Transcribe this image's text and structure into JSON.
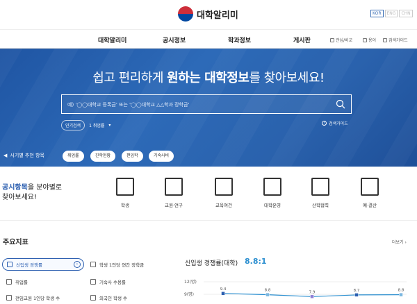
{
  "header": {
    "logo_text": "대학알리미",
    "langs": [
      "KOR",
      "ENG",
      "CHN"
    ],
    "active_lang": "KOR"
  },
  "nav": {
    "items": [
      "대학알리미",
      "공시정보",
      "학과정보",
      "게시판"
    ],
    "util": [
      "관심/비교",
      "용어",
      "검색가이드"
    ]
  },
  "hero": {
    "headline_pre": "쉽고 편리하게 ",
    "headline_bold1": "원하는 대학정보",
    "headline_post": "를 찾아보세요!",
    "search_placeholder": "예) '◯◯대학교 등록금' 또는 '◯◯대학교 △△학과 장학금'",
    "popular_label": "인기검색",
    "popular_value": "1 취업률",
    "guide_label": "검색가이드"
  },
  "recommend": {
    "label": "시기별 추천 항목",
    "chips": [
      "취업률",
      "진학현황",
      "편입학",
      "기숙사비"
    ]
  },
  "category": {
    "title_bold": "공시항목",
    "title_rest1": "을 분야별로",
    "title_rest2": "찾아보세요!",
    "items": [
      {
        "label": "학생",
        "icon": "student-card-icon"
      },
      {
        "label": "교원·연구",
        "icon": "lecture-board-icon"
      },
      {
        "label": "교육여건",
        "icon": "book-icon"
      },
      {
        "label": "대학운영",
        "icon": "building-icon"
      },
      {
        "label": "산학협력",
        "icon": "briefcase-icon"
      },
      {
        "label": "예·결산",
        "icon": "calculator-icon"
      }
    ]
  },
  "indicators": {
    "title": "주요지표",
    "more": "더보기",
    "items": [
      "신입생 경쟁률",
      "학생 1인당 연간 장학금",
      "취업률",
      "기숙사 수용률",
      "전임교원 1인당 학생 수",
      "외국인 학생 수"
    ],
    "active": "신입생 경쟁률"
  },
  "chart_data": {
    "type": "line",
    "title": "신입생 경쟁률(대학)",
    "summary": "8.8:1",
    "values": [
      9.4,
      8.8,
      7.9,
      8.7,
      8.8
    ],
    "yticks": [
      "12(명)",
      "9(명)"
    ],
    "ylim": [
      6,
      12
    ]
  }
}
